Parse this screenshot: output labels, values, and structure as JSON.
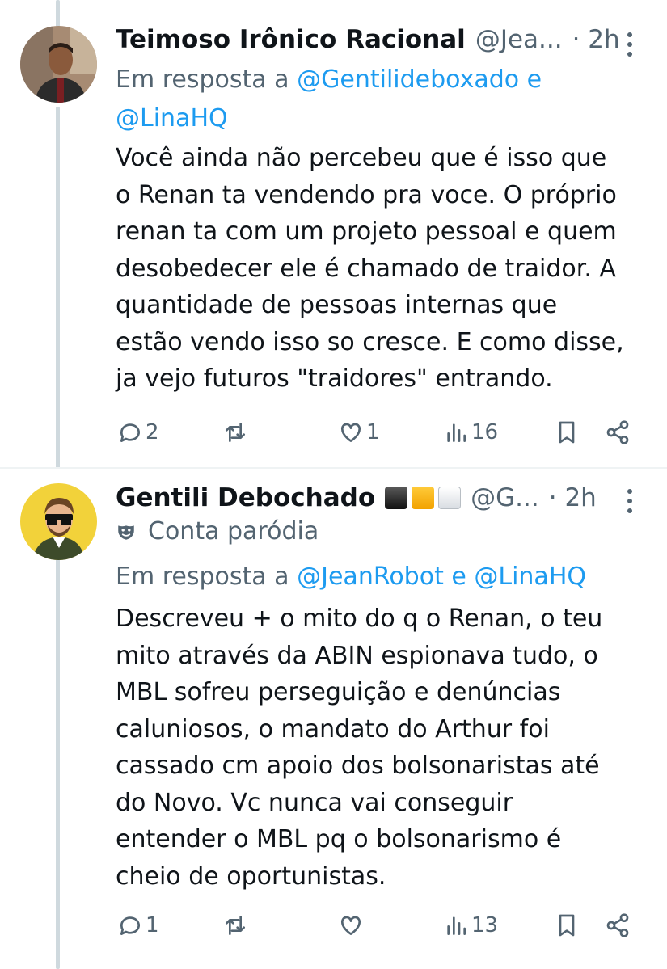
{
  "tweets": [
    {
      "name": "Teimoso Irônico Racional",
      "handle": "@Jea...",
      "time": "· 2h",
      "reply_prefix": "Em resposta a",
      "reply_mentions": "@Gentilideboxado e @LinaHQ",
      "text": "Você ainda não percebeu que é isso que\no Renan ta vendendo pra voce. O próprio\nrenan ta com um projeto pessoal e quem\ndesobedecer ele é chamado de traidor. A\nquantidade de pessoas internas que\nestão vendo isso so cresce. E como disse,\nja vejo futuros \"traidores\" entrando.",
      "replies": "2",
      "likes": "1",
      "views": "16"
    },
    {
      "name": "Gentili Debochado",
      "handle": "@G...",
      "time": "· 2h",
      "parody_label": "Conta paródia",
      "reply_prefix": "Em resposta a",
      "reply_mentions": "@JeanRobot e @LinaHQ",
      "text": "Descreveu + o mito do q o Renan, o teu\nmito através da ABIN espionava tudo, o\nMBL sofreu perseguição e denúncias\ncaluniosos, o mandato do Arthur foi\ncassado cm apoio dos bolsonaristas até\ndo Novo. Vc nunca vai conseguir\nentender o MBL pq o bolsonarismo é\ncheio de oportunistas.",
      "replies": "1",
      "likes": "",
      "views": "13",
      "badges": [
        "black",
        "orange",
        "white"
      ]
    }
  ],
  "colors": {
    "text": "#0f1419",
    "secondary": "#536471",
    "link": "#1d9bf0",
    "thread_line": "#cfd9de"
  },
  "icons": [
    "reply-icon",
    "retweet-icon",
    "like-icon",
    "views-icon",
    "bookmark-icon",
    "share-icon",
    "more-icon",
    "parody-mask-icon"
  ]
}
